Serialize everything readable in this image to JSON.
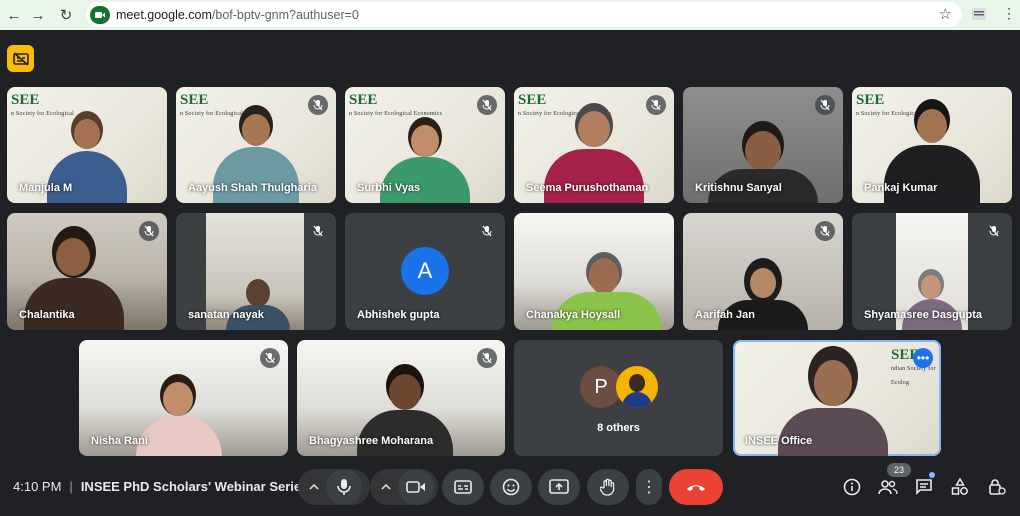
{
  "browser": {
    "url_host": "meet.google.com",
    "url_path": "/bof-bptv-gnm?authuser=0"
  },
  "participants": [
    {
      "name": "Manjula M",
      "muted": false,
      "logo": "SEE",
      "logo_sub": "n Society for Ecological"
    },
    {
      "name": "Aayush Shah Thulgharia",
      "muted": true,
      "logo": "SEE",
      "logo_sub": "n Society for Ecological"
    },
    {
      "name": "Surbhi Vyas",
      "muted": true,
      "logo": "SEE",
      "logo_sub": "n Society for Ecological Economics"
    },
    {
      "name": "Seema Purushothaman",
      "muted": true,
      "logo": "SEE",
      "logo_sub": "n Society for Ecological Economics"
    },
    {
      "name": "Kritishnu Sanyal",
      "muted": true
    },
    {
      "name": "Pankaj Kumar",
      "muted": false,
      "logo": "SEE",
      "logo_sub": "n Society for Ecological"
    },
    {
      "name": "Chalantika",
      "muted": true
    },
    {
      "name": "sanatan nayak",
      "muted": true
    },
    {
      "name": "Abhishek gupta",
      "muted": true,
      "initial": "A"
    },
    {
      "name": "Chanakya Hoysall",
      "muted": false
    },
    {
      "name": "Aarifah Jan",
      "muted": true
    },
    {
      "name": "Shyamasree Dasgupta",
      "muted": true
    },
    {
      "name": "Nisha Rani",
      "muted": true
    },
    {
      "name": "Bhagyashree Moharana",
      "muted": true
    },
    {
      "name": "INSEE Office",
      "muted": false,
      "logo": "SEE",
      "logo_sub": "ndian Society for Ecolog"
    }
  ],
  "others": {
    "initial": "P",
    "label": "8 others"
  },
  "meeting": {
    "time": "4:10 PM",
    "title": "INSEE PhD Scholars' Webinar Serie..."
  },
  "people_count": "23",
  "colors": {
    "end_call": "#ea4335",
    "active_border": "#8ab4f8",
    "avatar_blue": "#1a73e8",
    "cc_badge": "#fbbc04"
  }
}
